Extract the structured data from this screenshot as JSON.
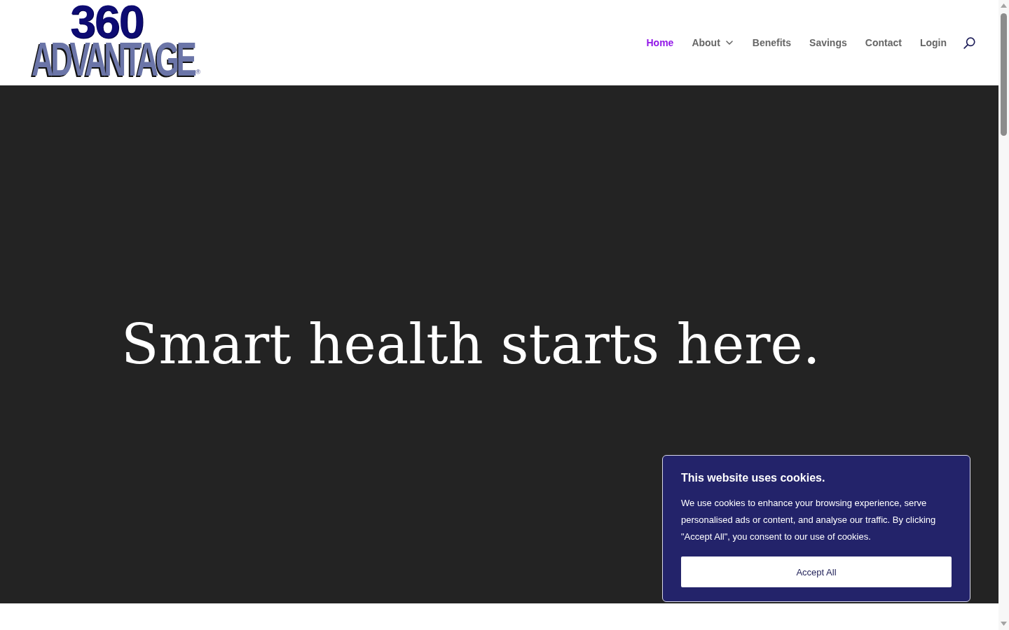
{
  "header": {
    "logo": {
      "number": "360",
      "wordmark": "ADVANTAGE",
      "mark": "®"
    },
    "nav": [
      {
        "label": "Home",
        "selected": true,
        "dropdown": false
      },
      {
        "label": "About",
        "selected": false,
        "dropdown": true
      },
      {
        "label": "Benefits",
        "selected": false,
        "dropdown": false
      },
      {
        "label": "Savings",
        "selected": false,
        "dropdown": false
      },
      {
        "label": "Contact",
        "selected": false,
        "dropdown": false
      },
      {
        "label": "Login",
        "selected": false,
        "dropdown": false
      }
    ]
  },
  "hero": {
    "headline": "Smart health starts here."
  },
  "cookie_banner": {
    "title": "This website uses cookies.",
    "text": "We use cookies to enhance your browsing experience, serve personalised ads or content, and analyse our traffic. By clicking \"Accept All\", you consent to our use of cookies.",
    "button": "Accept All"
  }
}
